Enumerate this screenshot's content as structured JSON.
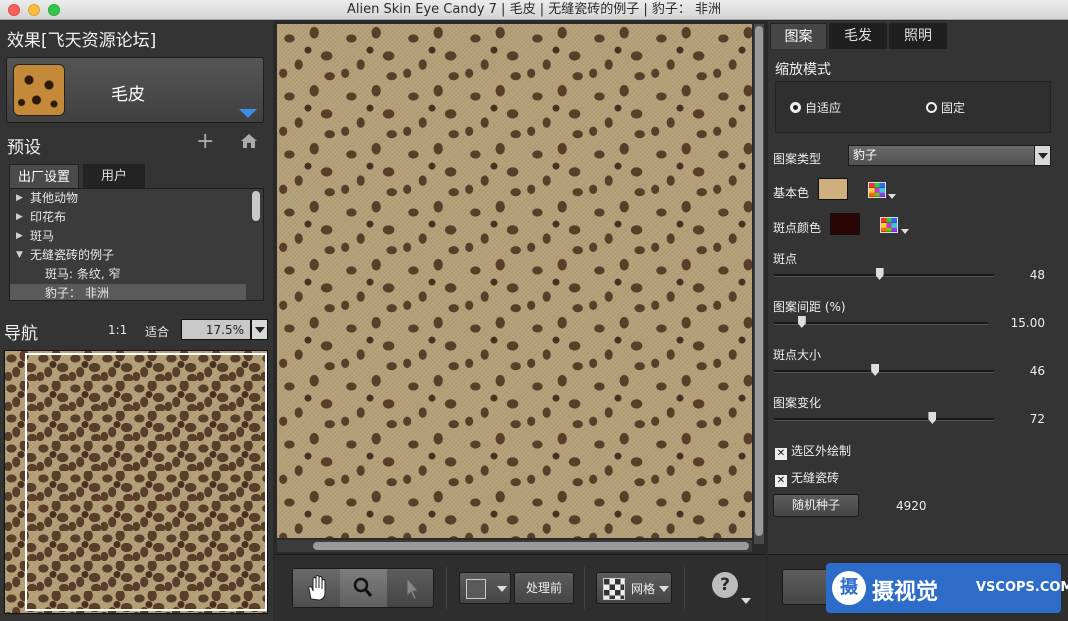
{
  "window": {
    "title": "Alien Skin Eye Candy 7 | 毛皮 | 无缝瓷砖的例子 | 豹子： 非洲"
  },
  "left_panel": {
    "effects_title": "效果[飞天资源论坛]",
    "current_effect": "毛皮",
    "presets_title": "预设",
    "tabs": [
      "出厂设置",
      "用户"
    ],
    "preset_items": [
      {
        "label": "其他动物",
        "expanded": false
      },
      {
        "label": "印花布",
        "expanded": false
      },
      {
        "label": "斑马",
        "expanded": false
      },
      {
        "label": "无缝瓷砖的例子",
        "expanded": true
      },
      {
        "label": "斑马: 条纹, 窄",
        "child": true
      },
      {
        "label": "豹子： 非洲",
        "child": true,
        "selected": true
      }
    ],
    "nav_title": "导航",
    "zoom_1to1": "1:1",
    "zoom_fit": "适合",
    "zoom_value": "17.5%"
  },
  "toolbar": {
    "before_label": "处理前",
    "grid_label": "网格",
    "help_label": "?"
  },
  "right_panel": {
    "tabs": [
      "图案",
      "毛发",
      "照明"
    ],
    "active_tab": "图案",
    "scale_mode_title": "缩放模式",
    "scale_options": [
      {
        "label": "自适应",
        "selected": true
      },
      {
        "label": "固定",
        "selected": false
      }
    ],
    "pattern_type_label": "图案类型",
    "pattern_type_value": "豹子",
    "base_color_label": "基本色",
    "base_color": "#cdb07e",
    "spot_color_label": "斑点颜色",
    "spot_color": "#2a0606",
    "sliders": [
      {
        "label": "斑点",
        "value": "48",
        "fraction": 0.48
      },
      {
        "label": "图案间距 (%)",
        "value": "15.00",
        "fraction": 0.13
      },
      {
        "label": "斑点大小",
        "value": "46",
        "fraction": 0.46
      },
      {
        "label": "图案变化",
        "value": "72",
        "fraction": 0.72
      }
    ],
    "checkboxes": [
      {
        "label": "选区外绘制",
        "checked": true
      },
      {
        "label": "无缝瓷砖",
        "checked": true
      }
    ],
    "random_seed_label": "随机种子",
    "random_seed_value": "4920"
  },
  "watermark": {
    "logo": "摄",
    "name": "摄视觉",
    "url": "VSCOPS.COM"
  }
}
